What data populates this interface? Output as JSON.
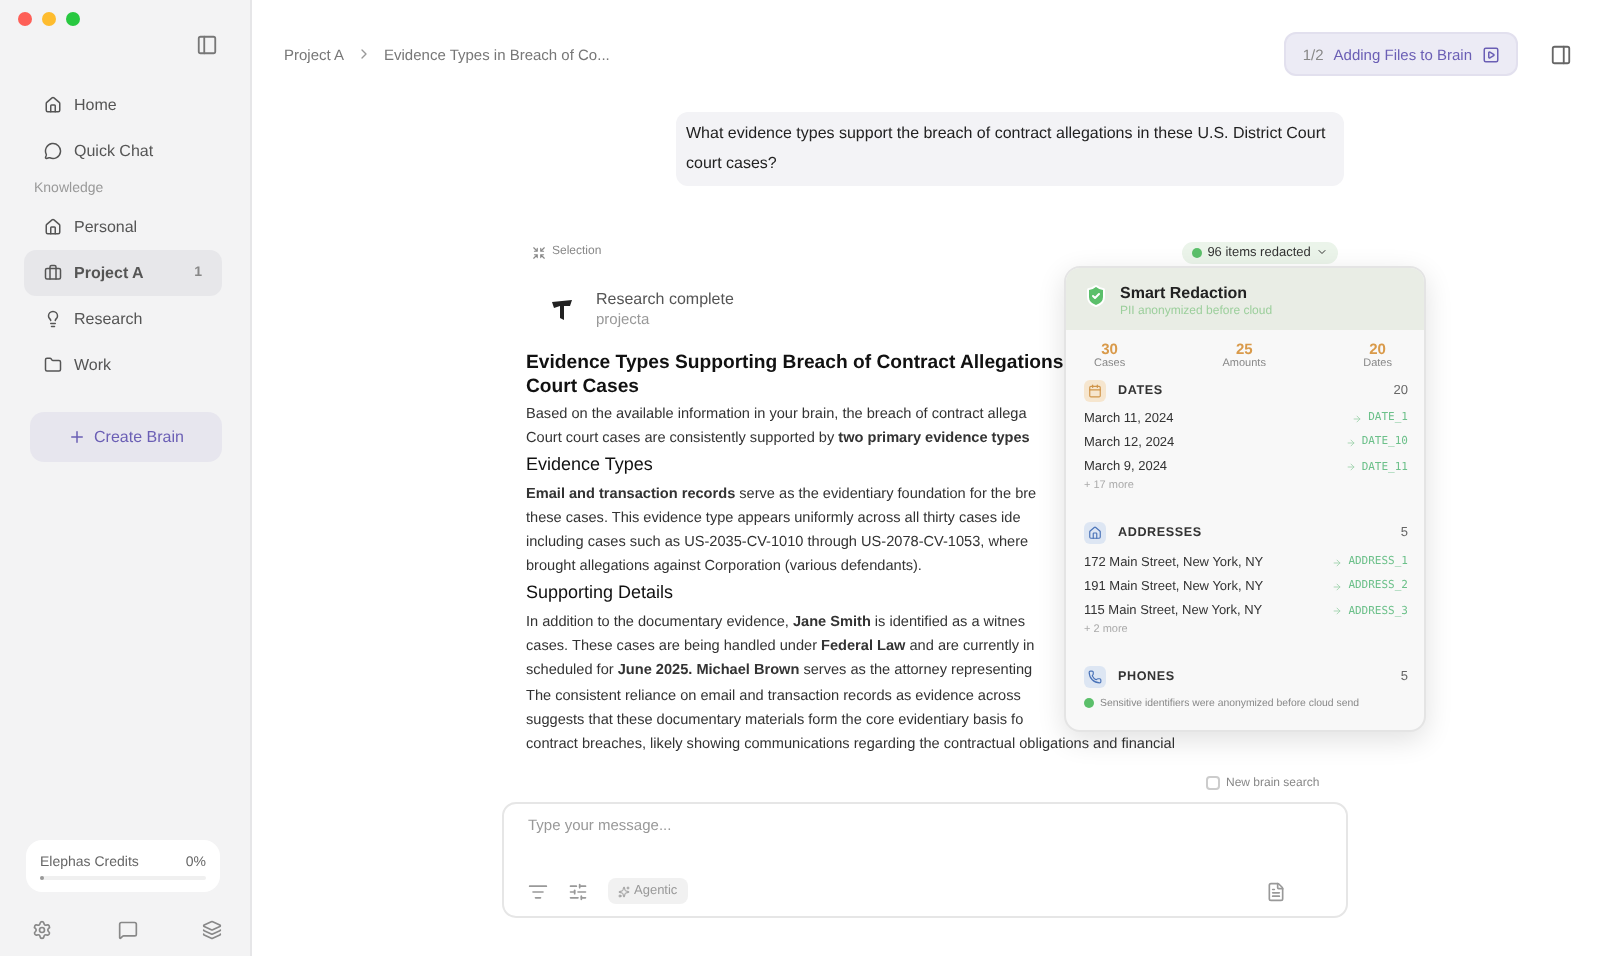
{
  "sidebar": {
    "items": [
      {
        "label": "Home",
        "selected": false
      },
      {
        "label": "Quick Chat",
        "selected": false
      }
    ],
    "section_label": "Knowledge",
    "brains": [
      {
        "label": "Personal",
        "selected": false
      },
      {
        "label": "Project A",
        "selected": true,
        "count": "1"
      },
      {
        "label": "Research",
        "selected": false
      },
      {
        "label": "Work",
        "selected": false
      }
    ],
    "create_button": "Create Brain",
    "credits": {
      "label": "Elephas Credits",
      "value": "0%",
      "level": 0
    }
  },
  "breadcrumb": [
    "Project A",
    "Evidence Types in Breach of Co..."
  ],
  "status_button": {
    "counter": "1/2",
    "label": "Adding Files to Brain"
  },
  "question": "What evidence types support the breach of contract allegations in these U.S. District Court court cases?",
  "selection_label": "Selection",
  "redaction_pill": "96 items redacted",
  "research": {
    "status": "Research complete",
    "brain": "projecta"
  },
  "article": [
    {
      "kind": "title",
      "lines": [
        "Evidence Types Supporting Breach of Contract Allegations",
        "Court Cases"
      ]
    },
    {
      "kind": "para",
      "lines": [
        "Based on the available information in your brain, the breach of contract allega",
        "Court court cases are consistently supported by **two primary evidence types**"
      ]
    },
    {
      "kind": "heading",
      "lines": [
        "Evidence Types"
      ]
    },
    {
      "kind": "para",
      "lines": [
        "**Email and transaction records** serve as the evidentiary foundation for the bre",
        "these cases. This evidence type appears uniformly across all thirty cases ide",
        "including cases such as US-2035-CV-1010 through US-2078-CV-1053, where",
        "brought allegations against Corporation (various defendants)."
      ]
    },
    {
      "kind": "heading",
      "lines": [
        "Supporting Details"
      ]
    },
    {
      "kind": "para",
      "lines": [
        "In addition to the documentary evidence, **Jane Smith** is identified as a witnes",
        "cases. These cases are being handled under **Federal Law** and are currently in",
        "scheduled for **June 2025. Michael Brown** serves as the attorney representing"
      ]
    },
    {
      "kind": "para",
      "lines": [
        "The consistent reliance on email and transaction records as evidence across",
        "suggests that these documentary materials form the core evidentiary basis fo",
        "contract breaches, likely showing communications regarding the contractual obligations and financial"
      ]
    }
  ],
  "redaction": {
    "title": "Smart Redaction",
    "subtitle": "PII anonymized before cloud",
    "stats": [
      {
        "value": "30",
        "label": "Cases"
      },
      {
        "value": "25",
        "label": "Amounts"
      },
      {
        "value": "20",
        "label": "Dates"
      }
    ],
    "groups": [
      {
        "kind": "dates",
        "title": "DATES",
        "count": "20",
        "items": [
          {
            "original": "March 11, 2024",
            "token": "DATE_1"
          },
          {
            "original": "March 12, 2024",
            "token": "DATE_10"
          },
          {
            "original": "March 9, 2024",
            "token": "DATE_11"
          }
        ],
        "more": "+ 17 more"
      },
      {
        "kind": "addresses",
        "title": "ADDRESSES",
        "count": "5",
        "items": [
          {
            "original": "172 Main Street, New York, NY",
            "token": "ADDRESS_1"
          },
          {
            "original": "191 Main Street, New York, NY",
            "token": "ADDRESS_2"
          },
          {
            "original": "115 Main Street, New York, NY",
            "token": "ADDRESS_3"
          }
        ],
        "more": "+ 2 more"
      },
      {
        "kind": "phones",
        "title": "PHONES",
        "count": "5"
      }
    ],
    "footer": "Sensitive identifiers were anonymized before cloud send"
  },
  "new_brain_search": {
    "label": "New brain search",
    "checked": false
  },
  "composer": {
    "placeholder": "Type your message...",
    "mode": "Agentic"
  }
}
